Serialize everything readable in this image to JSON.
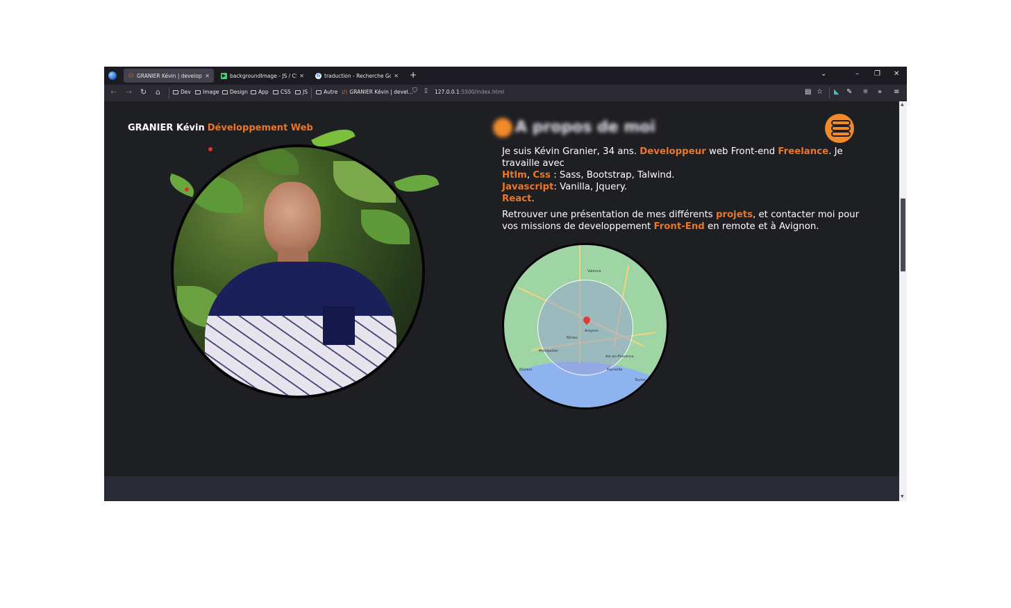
{
  "tabs": [
    {
      "title": "GRANIER Kévin | developpeur w",
      "favicon": "code-favicon",
      "active": true
    },
    {
      "title": "backgroundImage - JS / CSS - P",
      "favicon": "codepen-favicon",
      "active": false
    },
    {
      "title": "traduction - Recherche Google",
      "favicon": "google-favicon",
      "active": false
    }
  ],
  "toolbar": {
    "new_tab": "+",
    "tab_list": "⌄",
    "minimize": "–",
    "restore": "❐",
    "close": "✕",
    "back": "←",
    "forward": "→",
    "reload": "↻",
    "home": "⌂"
  },
  "bookmarks": [
    "Dev",
    "Image",
    "Design",
    "App",
    "CSS",
    "JS",
    "Autre",
    "GRANIER Kévin | devel..."
  ],
  "url": {
    "host": "127.0.0.1",
    "rest": ":5500/index.html"
  },
  "page": {
    "brand": {
      "name": "GRANIER Kévin",
      "tagline": "Développement Web"
    },
    "about_title": "A propos de moi",
    "intro": {
      "t1": "Je suis Kévin Granier, 34 ans. ",
      "h1": "Developpeur",
      "t2": " web Front-end ",
      "h2": "Freelance",
      "t3": ". Je travaille avec"
    },
    "skills": {
      "html": "Htlm",
      "comma": ", ",
      "css": "Css",
      "css_list": " : Sass, Bootstrap, Talwind.",
      "js": "Javascript",
      "js_list": ": Vanilla, Jquery.",
      "react": "React",
      "react_end": "."
    },
    "contact": {
      "t1": "Retrouver une présentation de mes différents ",
      "h1": "projets",
      "t2": ", et contacter moi pour vos missions de developpement ",
      "h2": "Front-End",
      "t3": " en remote et à Avignon."
    },
    "map_cities": [
      "Valence",
      "Avignon",
      "Nîmes",
      "Montpellier",
      "Aix-en-Provence",
      "Marseille",
      "Béziers",
      "Toulon"
    ]
  },
  "colors": {
    "accent": "#e8772a",
    "background": "#1e1f23",
    "footer_band": "#282b35"
  }
}
